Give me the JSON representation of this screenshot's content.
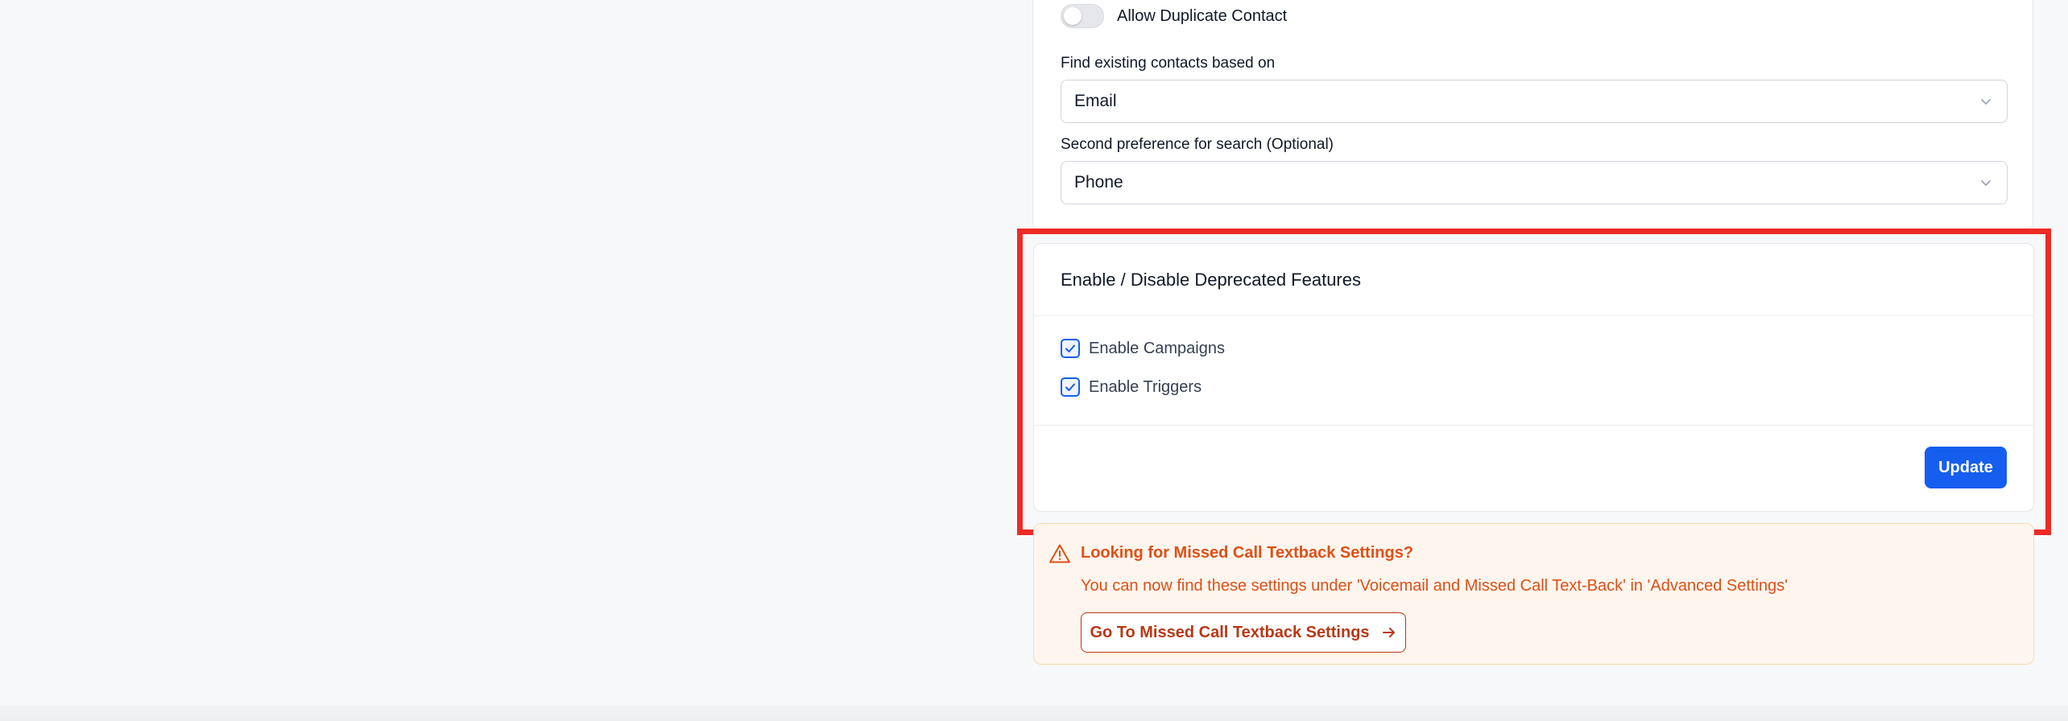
{
  "contact_settings": {
    "allow_duplicate_label": "Allow Duplicate Contact",
    "allow_duplicate_enabled": false,
    "primary_search_label": "Find existing contacts based on",
    "primary_search_value": "Email",
    "secondary_search_label": "Second preference for search (Optional)",
    "secondary_search_value": "Phone"
  },
  "deprecated_features": {
    "title": "Enable / Disable Deprecated Features",
    "options": [
      {
        "label": "Enable Campaigns",
        "checked": true
      },
      {
        "label": "Enable Triggers",
        "checked": true
      }
    ],
    "update_label": "Update"
  },
  "missed_call_notice": {
    "title": "Looking for Missed Call Textback Settings?",
    "text": "You can now find these settings under 'Voicemail and Missed Call Text-Back' in 'Advanced Settings'",
    "button_label": "Go To Missed Call Textback Settings",
    "icon": "warning-triangle-icon"
  },
  "colors": {
    "primary": "#155eef",
    "highlight": "#ee2a24",
    "warning_text": "#e04f16",
    "warning_bg": "#fef6ee"
  }
}
